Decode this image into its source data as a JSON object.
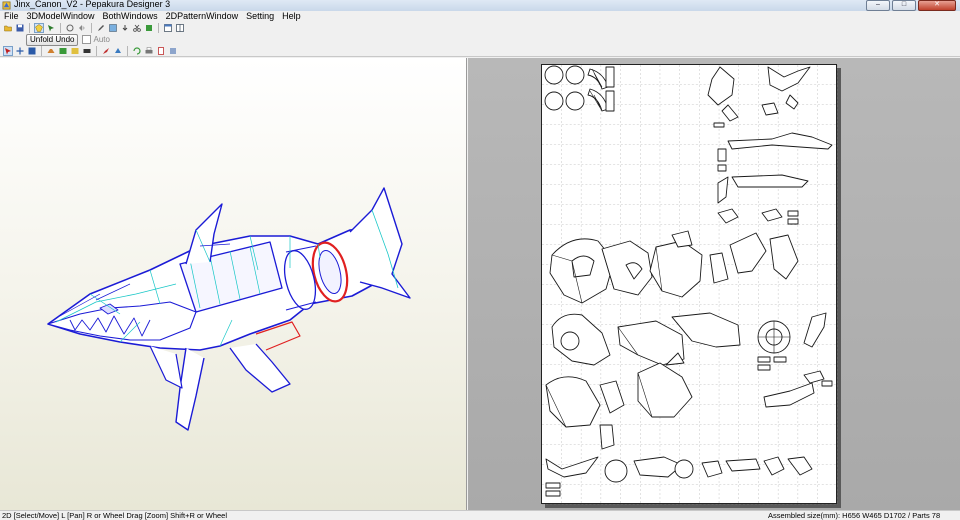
{
  "window": {
    "title": "Jinx_Canon_V2 - Pepakura Designer 3",
    "controls": [
      "–",
      "□",
      "✕"
    ]
  },
  "menu": [
    "File",
    "3DModelWindow",
    "BothWindows",
    "2DPatternWindow",
    "Setting",
    "Help"
  ],
  "toolbar2": {
    "unfold_undo": "Unfold Undo",
    "auto_label": "Auto"
  },
  "status": {
    "left": "2D [Select/Move] L [Pan] R or Wheel Drag [Zoom] Shift+R or Wheel",
    "right": "Assembled size(mm): H656 W465 D1702 / Parts 78"
  },
  "colors": {
    "model_edge": "#1b1bd6",
    "model_fold": "#19c7c7",
    "accent_red": "#e02020",
    "viewport_bg": "#f4f3ea",
    "sheet_bg": "#acacac"
  },
  "icons": {
    "toolbar1": [
      "open-icon",
      "save-icon",
      "sep",
      "unfold-icon",
      "select-icon",
      "sep",
      "rotate-icon",
      "flip-icon",
      "sep",
      "edit-icon",
      "texture-icon",
      "join-icon",
      "cut-icon",
      "crop-icon",
      "sep",
      "window-icon",
      "window2-icon"
    ],
    "toolbar3": [
      "select-arrow-icon",
      "move-icon",
      "layout-icon",
      "sep",
      "flap-icon",
      "edge-icon",
      "fold-icon",
      "number-icon",
      "sep",
      "paint-icon",
      "tab-icon",
      "sep",
      "rotate-part-icon",
      "print-icon",
      "page-icon",
      "scale-icon"
    ]
  }
}
